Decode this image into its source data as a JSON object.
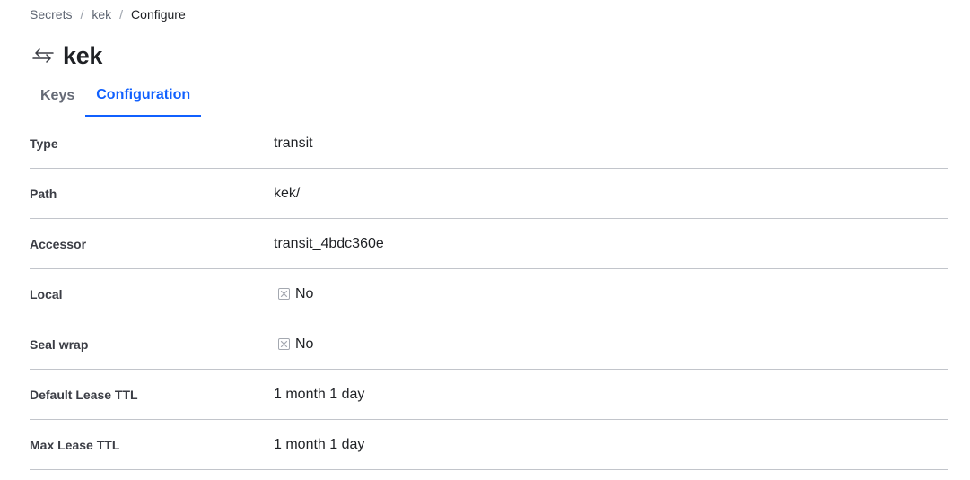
{
  "breadcrumb": {
    "items": [
      "Secrets",
      "kek"
    ],
    "separator": "/",
    "current": "Configure"
  },
  "header": {
    "title": "kek",
    "icon": "arrows-left-right-icon"
  },
  "tabs": [
    {
      "label": "Keys",
      "active": false
    },
    {
      "label": "Configuration",
      "active": true
    }
  ],
  "config": {
    "rows": [
      {
        "label": "Type",
        "value": "transit"
      },
      {
        "label": "Path",
        "value": "kek/"
      },
      {
        "label": "Accessor",
        "value": "transit_4bdc360e"
      },
      {
        "label": "Local",
        "value": "No",
        "icon": "x-square-icon"
      },
      {
        "label": "Seal wrap",
        "value": "No",
        "icon": "x-square-icon"
      },
      {
        "label": "Default Lease TTL",
        "value": "1 month 1 day"
      },
      {
        "label": "Max Lease TTL",
        "value": "1 month 1 day"
      }
    ]
  },
  "colors": {
    "accent": "#1060ff",
    "text": "#1f2125",
    "muted": "#656a76",
    "border": "#c2c5cb"
  }
}
